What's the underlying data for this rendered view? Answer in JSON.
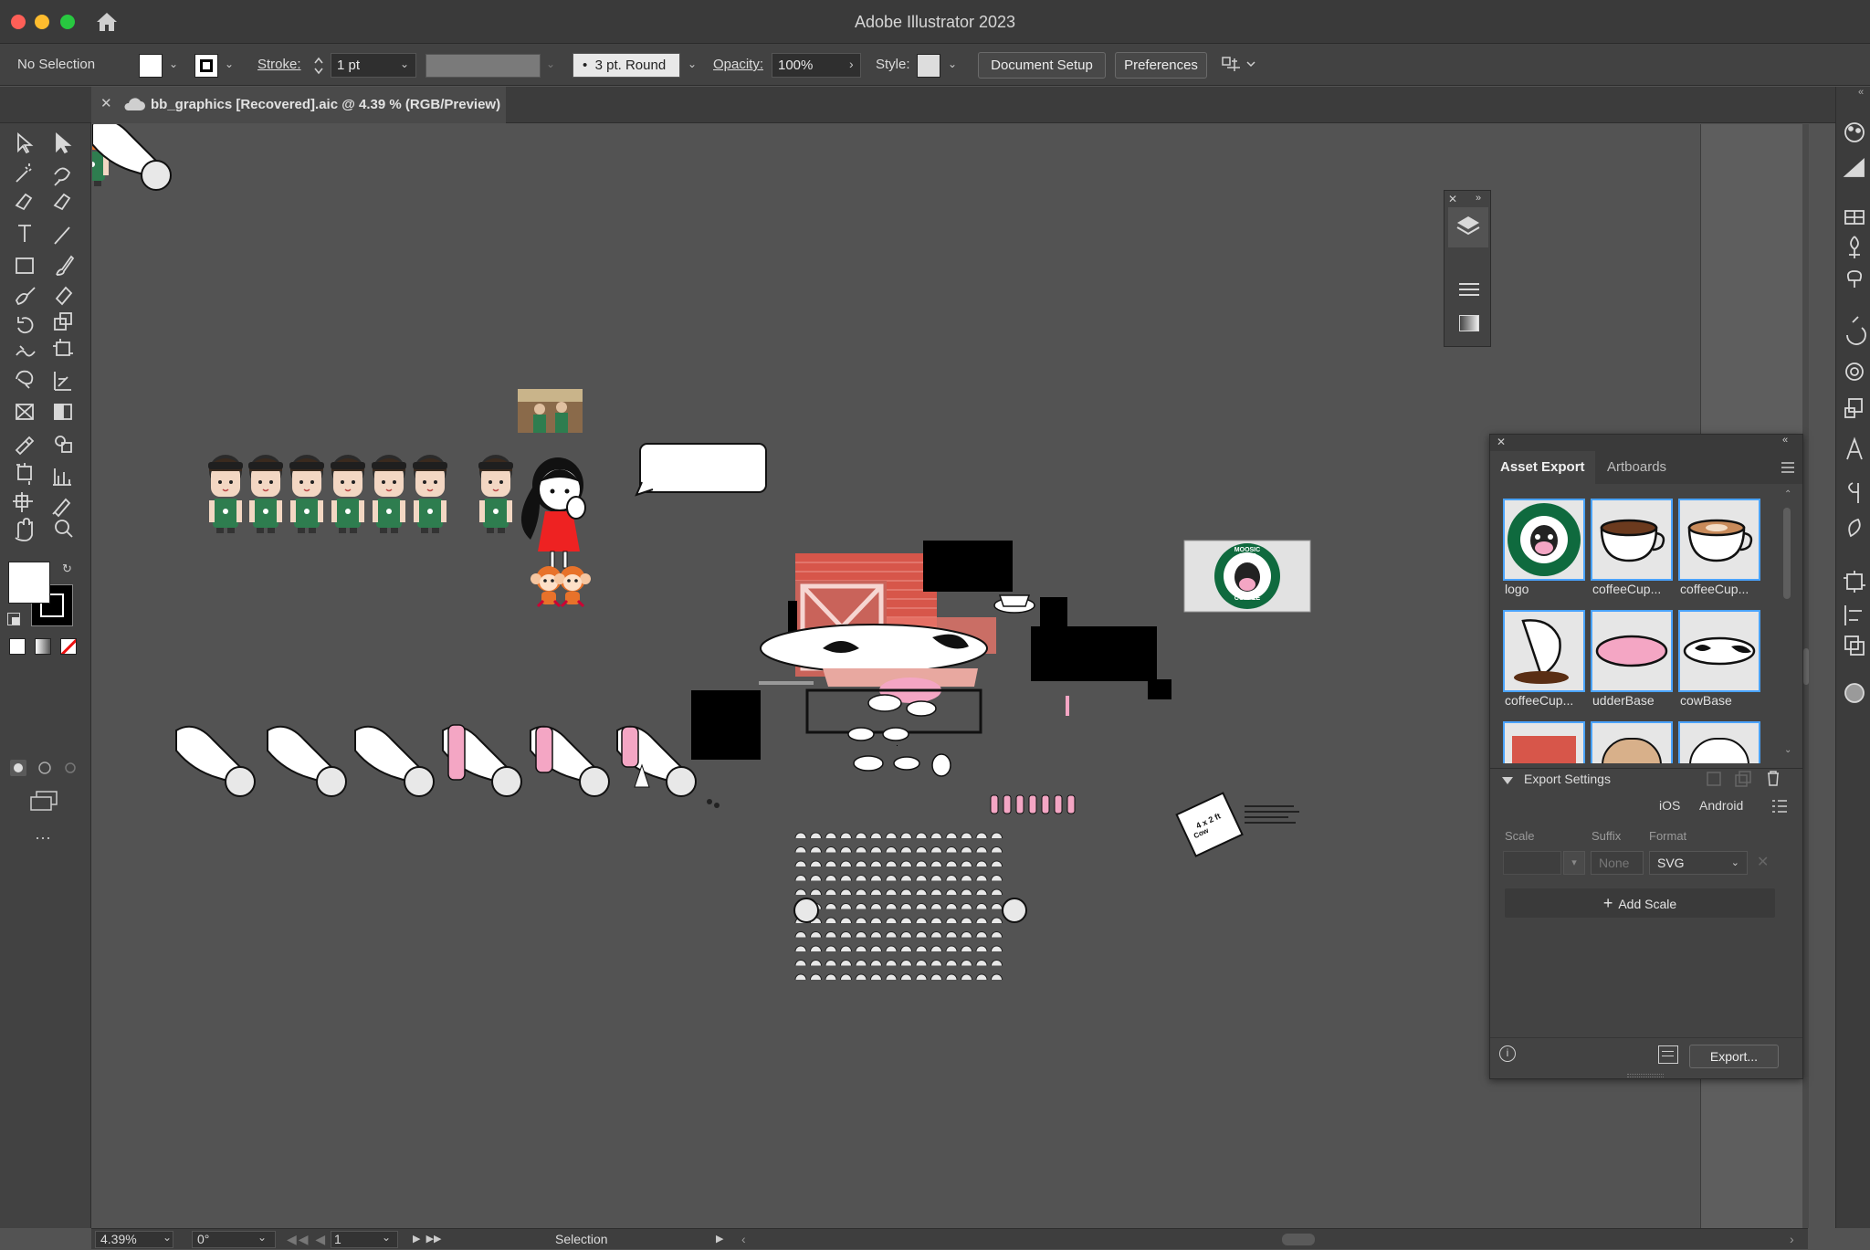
{
  "window": {
    "title": "Adobe Illustrator 2023"
  },
  "control_bar": {
    "selection": "No Selection",
    "stroke_label": "Stroke:",
    "stroke_weight": "1 pt",
    "brush": "3 pt. Round",
    "opacity_label": "Opacity:",
    "opacity_value": "100%",
    "style_label": "Style:",
    "document_setup": "Document Setup",
    "preferences": "Preferences"
  },
  "document": {
    "tab_title": "bb_graphics [Recovered].aic @ 4.39 % (RGB/Preview)"
  },
  "status_bar": {
    "zoom": "4.39%",
    "rotation": "0°",
    "artboard": "1",
    "tool": "Selection"
  },
  "asset_export": {
    "tabs": [
      "Asset Export",
      "Artboards"
    ],
    "assets": [
      {
        "label": "logo",
        "icon": "coffee-logo-icon"
      },
      {
        "label": "coffeeCup...",
        "icon": "coffee-cup-icon"
      },
      {
        "label": "coffeeCup...",
        "icon": "latte-cup-icon"
      },
      {
        "label": "coffeeCup...",
        "icon": "spilled-cup-icon"
      },
      {
        "label": "udderBase",
        "icon": "udder-icon"
      },
      {
        "label": "cowBase",
        "icon": "cow-pattern-icon"
      }
    ],
    "export_settings": "Export Settings",
    "platforms": [
      "iOS",
      "Android"
    ],
    "columns": [
      "Scale",
      "Suffix",
      "Format"
    ],
    "suffix_placeholder": "None",
    "format": "SVG",
    "add_scale": "Add Scale",
    "export_button": "Export..."
  },
  "artwork": {
    "cafe_sign": "MOOSIC CAFE",
    "cafe_sign_bottom": "COFFEE",
    "tag_text": "4 x 2 ft",
    "tag_text2": "Cow"
  },
  "colors": {
    "accent": "#4aa3ff",
    "chrome": "#424242",
    "canvas": "#535353",
    "artboard": "#5a5a5a"
  }
}
